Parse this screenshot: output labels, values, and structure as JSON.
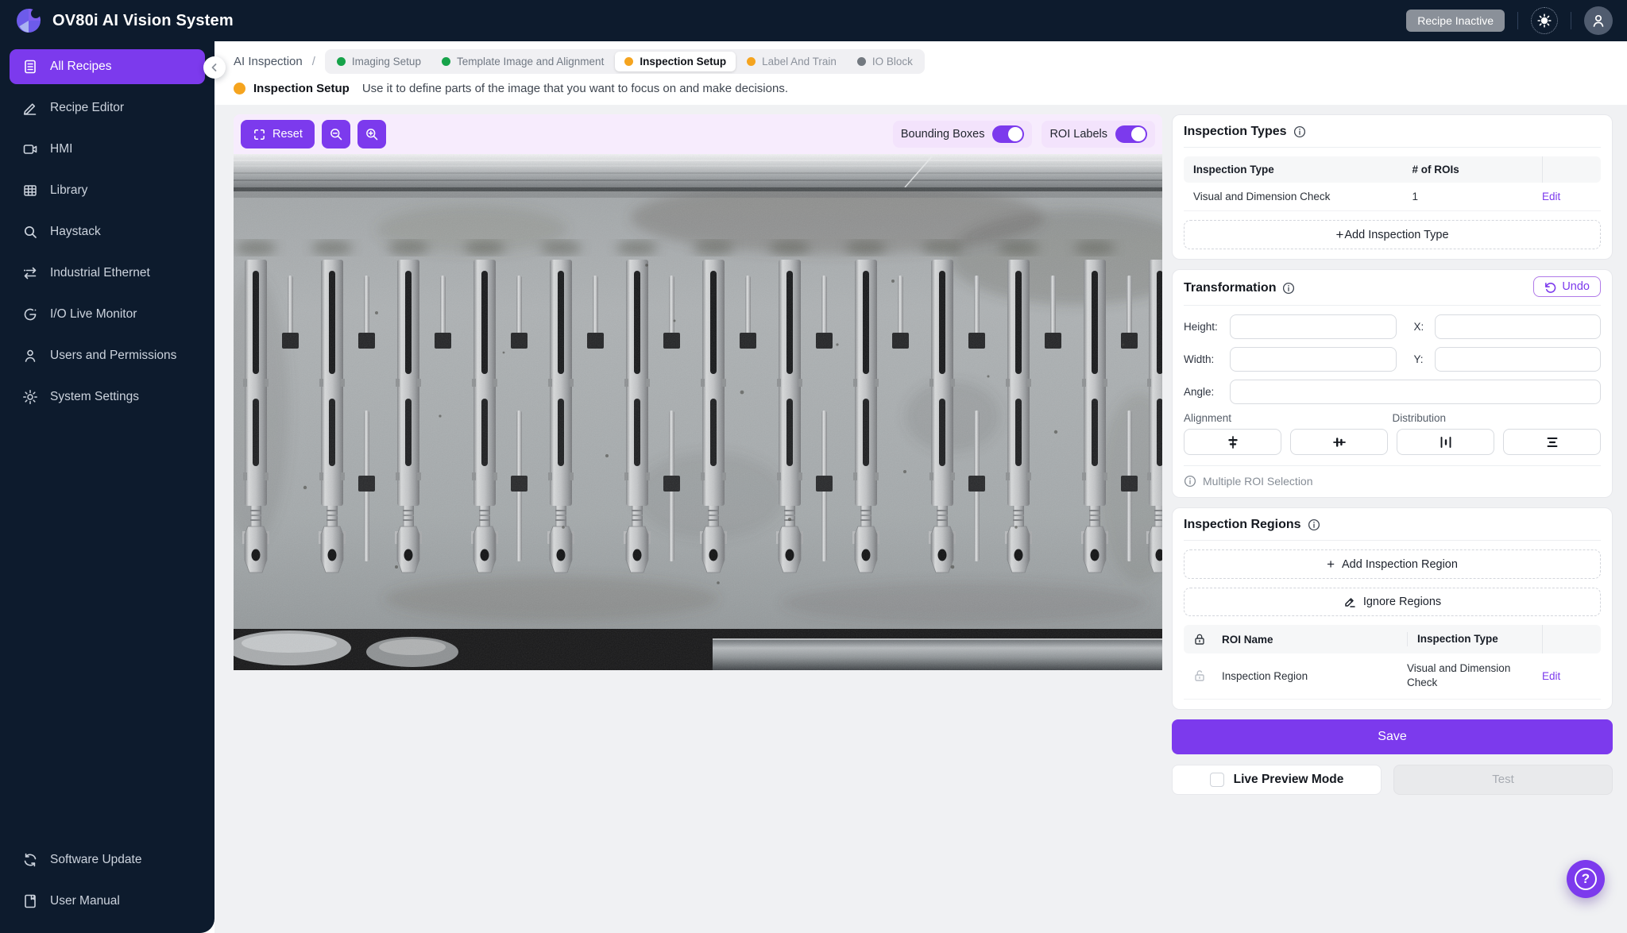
{
  "topbar": {
    "title": "OV80i AI Vision System",
    "recipe_status": "Recipe Inactive"
  },
  "sidebar": {
    "items": [
      {
        "label": "All Recipes"
      },
      {
        "label": "Recipe Editor"
      },
      {
        "label": "HMI"
      },
      {
        "label": "Library"
      },
      {
        "label": "Haystack"
      },
      {
        "label": "Industrial Ethernet"
      },
      {
        "label": "I/O Live Monitor"
      },
      {
        "label": "Users and Permissions"
      },
      {
        "label": "System Settings"
      }
    ],
    "bottom_items": [
      {
        "label": "Software Update"
      },
      {
        "label": "User Manual"
      }
    ]
  },
  "breadcrumb": {
    "root": "AI Inspection",
    "separator": "/"
  },
  "steps": [
    {
      "label": "Imaging Setup",
      "status": "done"
    },
    {
      "label": "Template Image and Alignment",
      "status": "done"
    },
    {
      "label": "Inspection Setup",
      "status": "active"
    },
    {
      "label": "Label And Train",
      "status": "upcoming"
    },
    {
      "label": "IO Block",
      "status": "pending"
    }
  ],
  "subtitle": {
    "label": "Inspection Setup",
    "description": "Use it to define parts of the image that you want to focus on and make decisions."
  },
  "toolbar": {
    "reset_label": "Reset",
    "bounding_boxes_label": "Bounding Boxes",
    "roi_labels_label": "ROI Labels"
  },
  "icons": {
    "plus": "+",
    "help": "?"
  },
  "inspection_types": {
    "title": "Inspection Types",
    "col_type": "Inspection Type",
    "col_rois": "# of ROIs",
    "row": {
      "type": "Visual and Dimension Check",
      "rois": "1",
      "action": "Edit"
    },
    "add_label": "Add Inspection Type"
  },
  "transformation": {
    "title": "Transformation",
    "undo_label": "Undo",
    "height_label": "Height:",
    "x_label": "X:",
    "width_label": "Width:",
    "y_label": "Y:",
    "angle_label": "Angle:",
    "alignment_label": "Alignment",
    "distribution_label": "Distribution",
    "multi_roi_label": "Multiple ROI Selection"
  },
  "inspection_regions": {
    "title": "Inspection Regions",
    "add_label": "Add Inspection Region",
    "ignore_label": "Ignore Regions",
    "col_name": "ROI Name",
    "col_type": "Inspection Type",
    "row": {
      "name": "Inspection Region",
      "type": "Visual and Dimension Check",
      "action": "Edit"
    }
  },
  "actions": {
    "save_label": "Save",
    "live_preview_label": "Live Preview Mode",
    "test_label": "Test"
  },
  "colors": {
    "primary": "#7c3aed",
    "navy": "#0d1b2d",
    "done_dot": "#17a34a",
    "active_dot": "#f5a41f",
    "pending_dot": "#737980"
  }
}
